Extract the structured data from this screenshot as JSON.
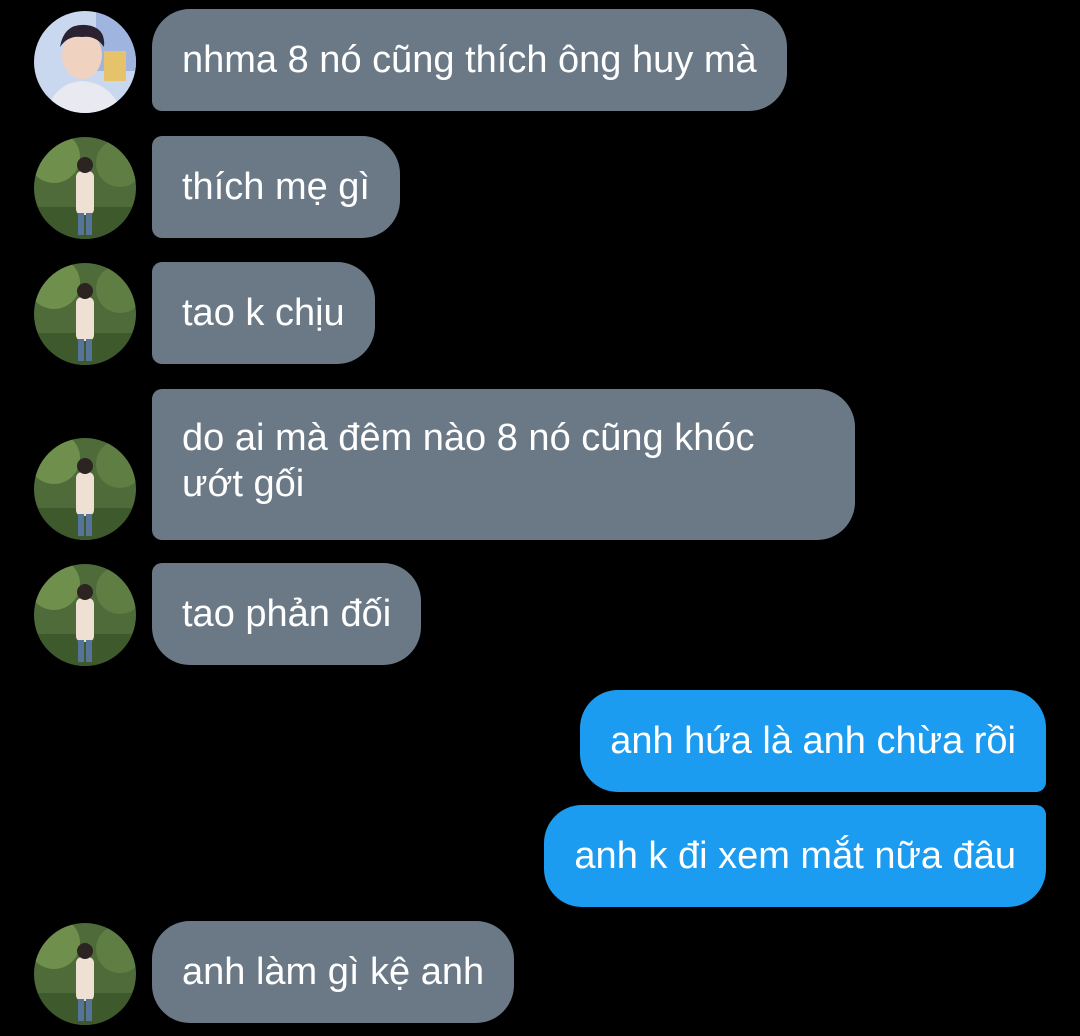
{
  "messages": [
    {
      "side": "in",
      "avatar": "avatar-a",
      "text": "nhma 8 nó cũng thích ông huy mà"
    },
    {
      "side": "in",
      "avatar": "avatar-b",
      "text": "thích mẹ gì"
    },
    {
      "side": "in",
      "avatar": "avatar-b",
      "text": "tao k chịu"
    },
    {
      "side": "in",
      "avatar": "avatar-b",
      "text": "do ai mà đêm nào 8 nó cũng khóc ướt gối"
    },
    {
      "side": "in",
      "avatar": "avatar-b",
      "text": "tao phản đối"
    },
    {
      "side": "out",
      "text": "anh hứa là anh chừa rồi"
    },
    {
      "side": "out",
      "text": "anh k đi xem mắt nữa đâu"
    },
    {
      "side": "in",
      "avatar": "avatar-b",
      "text": "anh làm gì kệ anh"
    }
  ],
  "colors": {
    "background": "#000000",
    "incoming_bubble": "#6b7987",
    "outgoing_bubble": "#1c9cf0",
    "text": "#ffffff"
  }
}
